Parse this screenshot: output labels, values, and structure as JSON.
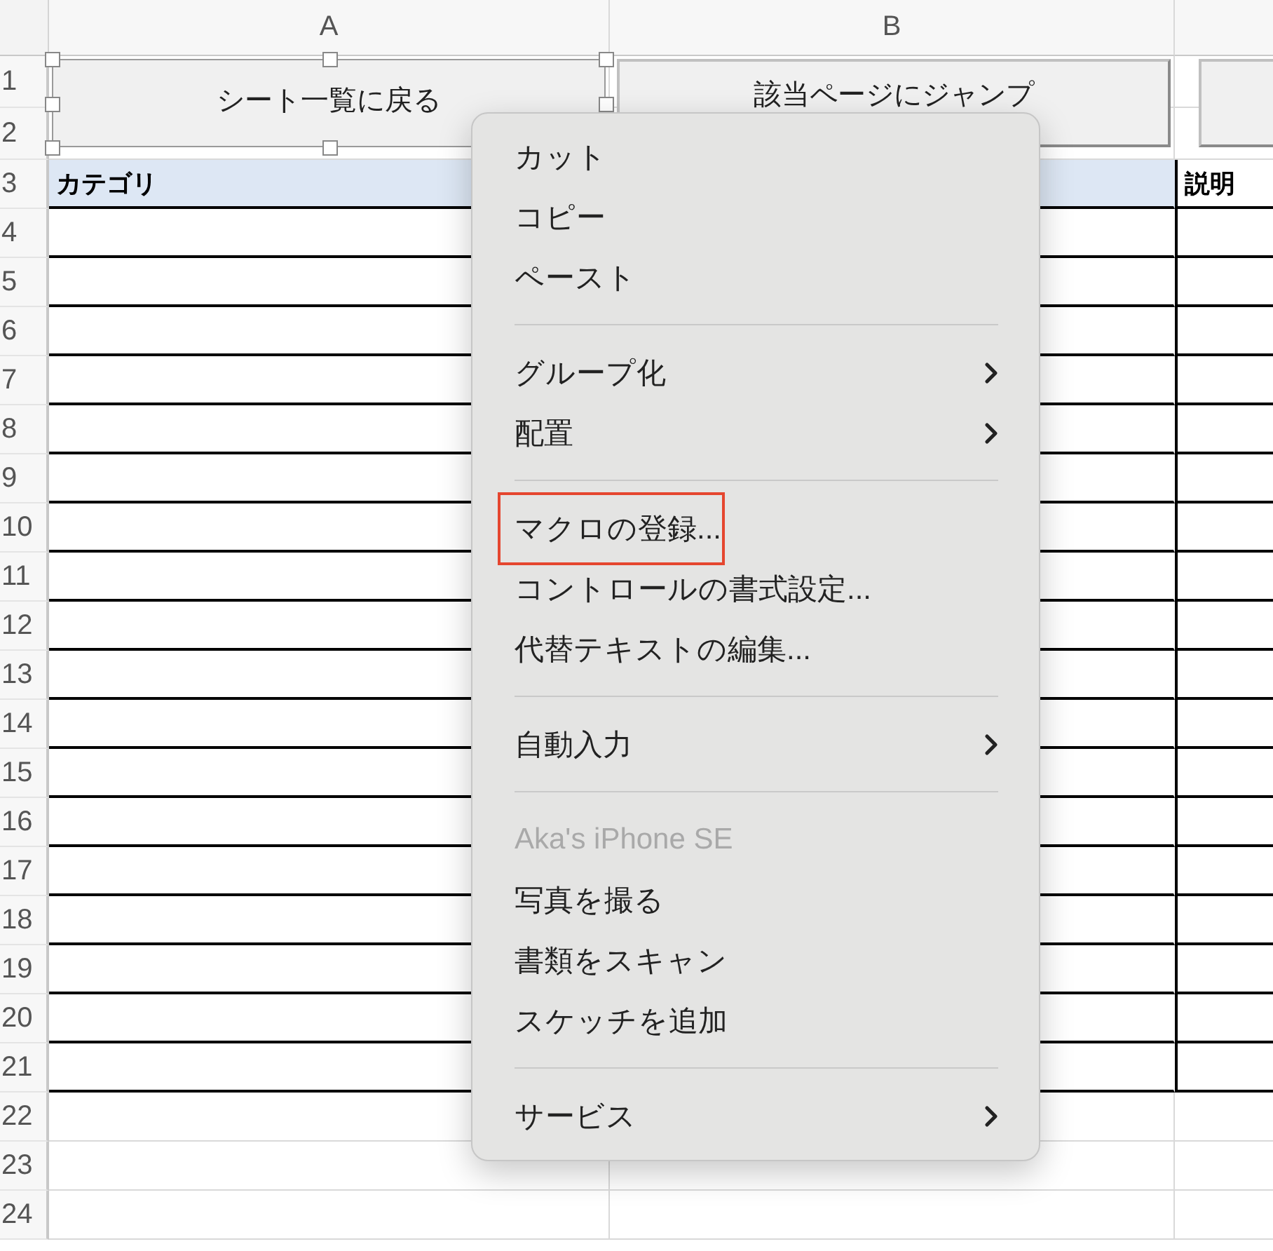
{
  "sheet": {
    "columns": [
      "A",
      "B"
    ],
    "rows": [
      {
        "number": "1",
        "bordered": false
      },
      {
        "number": "2",
        "bordered": false
      },
      {
        "number": "3",
        "bordered": true,
        "header": true
      },
      {
        "number": "4",
        "bordered": true
      },
      {
        "number": "5",
        "bordered": true
      },
      {
        "number": "6",
        "bordered": true
      },
      {
        "number": "7",
        "bordered": true
      },
      {
        "number": "8",
        "bordered": true
      },
      {
        "number": "9",
        "bordered": true
      },
      {
        "number": "10",
        "bordered": true
      },
      {
        "number": "11",
        "bordered": true
      },
      {
        "number": "12",
        "bordered": true
      },
      {
        "number": "13",
        "bordered": true
      },
      {
        "number": "14",
        "bordered": true
      },
      {
        "number": "15",
        "bordered": true
      },
      {
        "number": "16",
        "bordered": true
      },
      {
        "number": "17",
        "bordered": true
      },
      {
        "number": "18",
        "bordered": true
      },
      {
        "number": "19",
        "bordered": true
      },
      {
        "number": "20",
        "bordered": true
      },
      {
        "number": "21",
        "bordered": true
      },
      {
        "number": "22",
        "bordered": false
      },
      {
        "number": "23",
        "bordered": false
      },
      {
        "number": "24",
        "bordered": false
      }
    ],
    "header_cells": {
      "column_1": "カテゴリ",
      "column_3": "説明"
    }
  },
  "form_buttons": [
    {
      "label": "シート一覧に戻る",
      "selected": true
    },
    {
      "label": "該当ページにジャンプ",
      "selected": false
    },
    {
      "selected": false
    }
  ],
  "context_menu": [
    {
      "kind": "item",
      "label": "カット"
    },
    {
      "kind": "item",
      "label": "コピー"
    },
    {
      "kind": "item",
      "label": "ペースト"
    },
    {
      "kind": "separator"
    },
    {
      "kind": "item",
      "label": "グループ化",
      "submenu": true
    },
    {
      "kind": "item",
      "label": "配置",
      "submenu": true
    },
    {
      "kind": "separator"
    },
    {
      "kind": "item",
      "label": "マクロの登録...",
      "highlighted": true
    },
    {
      "kind": "item",
      "label": "コントロールの書式設定..."
    },
    {
      "kind": "item",
      "label": "代替テキストの編集..."
    },
    {
      "kind": "separator"
    },
    {
      "kind": "item",
      "label": "自動入力",
      "submenu": true
    },
    {
      "kind": "separator"
    },
    {
      "kind": "header",
      "label": "Aka's iPhone SE"
    },
    {
      "kind": "item",
      "label": "写真を撮る"
    },
    {
      "kind": "item",
      "label": "書類をスキャン"
    },
    {
      "kind": "item",
      "label": "スケッチを追加"
    },
    {
      "kind": "separator"
    },
    {
      "kind": "item",
      "label": "サービス",
      "submenu": true
    }
  ]
}
